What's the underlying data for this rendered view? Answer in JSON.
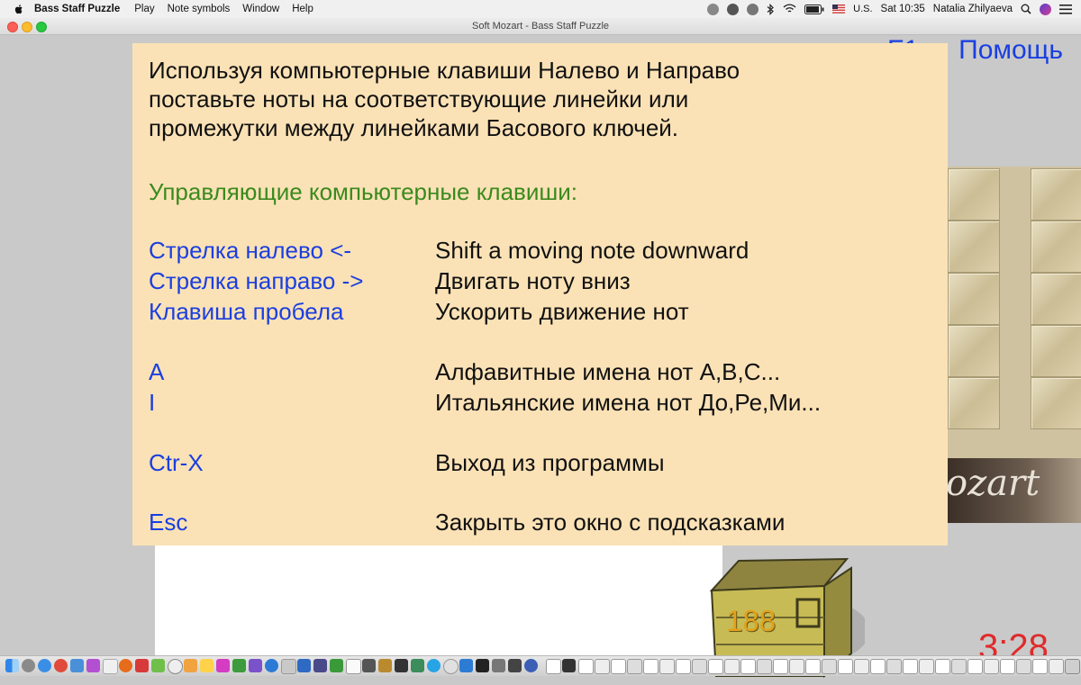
{
  "menubar": {
    "app": "Bass Staff Puzzle",
    "items": [
      "Play",
      "Note symbols",
      "Window",
      "Help"
    ],
    "input_source": "U.S.",
    "clock": "Sat 10:35",
    "user": "Natalia Zhilyaeva"
  },
  "window": {
    "title": "Soft Mozart - Bass Staff Puzzle"
  },
  "game": {
    "help_link_key": "F1",
    "help_link": "Помощь",
    "counter": "188",
    "timer": "3:28",
    "logo": "ozart"
  },
  "help_overlay": {
    "intro_lines": [
      "Используя компьютерные клавиши Налево и Направо",
      "поставьте ноты на соответствующие линейки или",
      "промежутки между линейками Басового ключей."
    ],
    "heading": "Управляющие компьютерные клавиши:",
    "shortcuts": [
      {
        "key": "Стрелка налево <-",
        "desc": "Shift a moving note downward"
      },
      {
        "key": "Стрелка направо ->",
        "desc": "Двигать ноту вниз"
      },
      {
        "key": "Клавиша пробела",
        "desc": "Ускорить движение нот"
      },
      {
        "key": "A",
        "desc": "Алфавитные имена нот A,B,C..."
      },
      {
        "key": "I",
        "desc": "Итальянские имена нот До,Ре,Ми..."
      },
      {
        "key": "Ctr-X",
        "desc": "Выход из программы"
      },
      {
        "key": "Esc",
        "desc": "Закрыть это окно с подсказками"
      }
    ]
  },
  "colors": {
    "overlay_bg": "#fbe2b6",
    "key_text": "#1a3fe0",
    "heading_text": "#3a8a1e",
    "timer": "#e02a2a",
    "counter": "#e1a11c"
  }
}
